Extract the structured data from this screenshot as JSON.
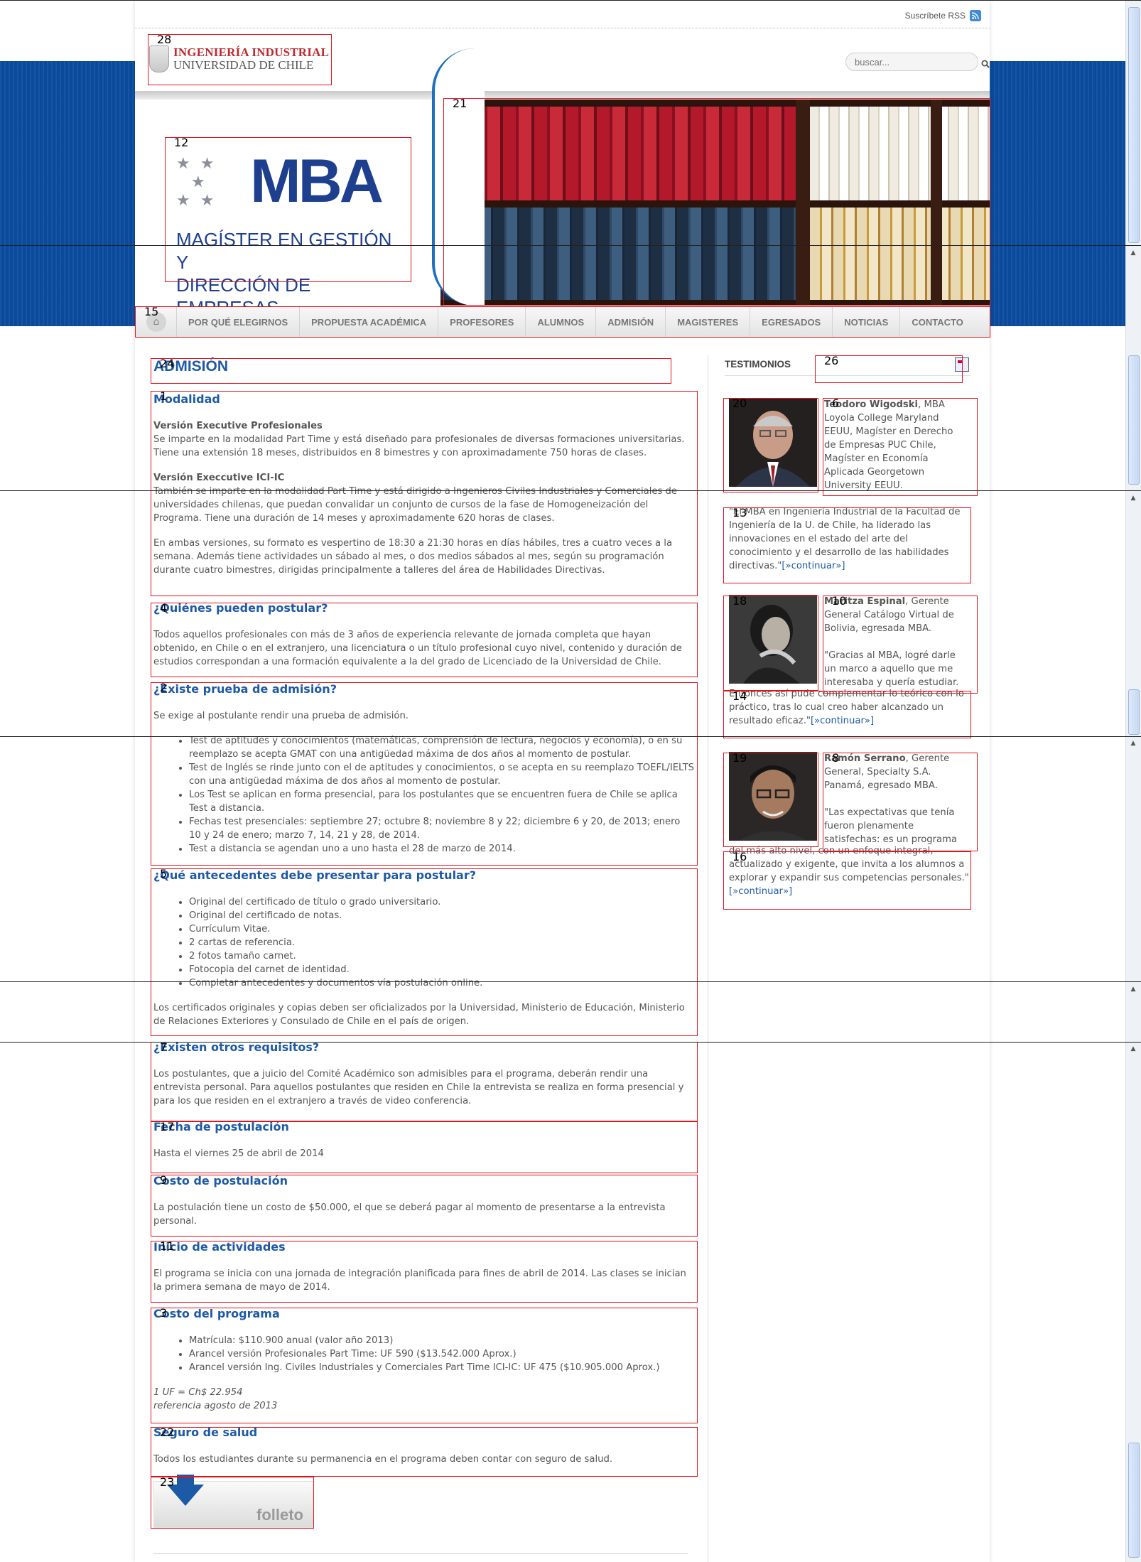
{
  "header": {
    "rss_label": "Suscríbete RSS",
    "logo_line1": "INGENIERÍA INDUSTRIAL",
    "logo_line2": "UNIVERSIDAD DE CHILE",
    "search_placeholder": "buscar..."
  },
  "banner": {
    "mba_title": "MBA",
    "mba_sub1": "MAGÍSTER EN GESTIÓN Y",
    "mba_sub2": "DIRECCIÓN DE EMPRESAS"
  },
  "nav": {
    "items": [
      {
        "label": "POR QUÉ ELEGIRNOS"
      },
      {
        "label": "PROPUESTA ACADÉMICA"
      },
      {
        "label": "PROFESORES"
      },
      {
        "label": "ALUMNOS"
      },
      {
        "label": "ADMISIÓN"
      },
      {
        "label": "MAGISTERES"
      },
      {
        "label": "EGRESADOS"
      },
      {
        "label": "NOTICIAS"
      },
      {
        "label": "CONTACTO"
      }
    ]
  },
  "main": {
    "page_title": "ADMISIÓN",
    "modalidad": {
      "title": "Modalidad",
      "sub1": "Versión Executive Profesionales",
      "p1": "Se imparte en la modalidad Part Time y está diseñado para profesionales de diversas formaciones universitarias. Tiene una extensión 18 meses, distribuidos en 8 bimestres y con aproximadamente 750 horas de clases.",
      "sub2": "Versión Execcutive ICI-IC",
      "p2": "También se imparte en la modalidad Part Time y está dirigido a Ingenieros Civiles Industriales y Comerciales de universidades chilenas, que puedan convalidar un conjunto de cursos de la fase de Homogeneización del Programa. Tiene una duración de 14 meses y aproximadamente 620 horas de clases.",
      "p3": "En ambas versiones, su formato es vespertino de 18:30 a 21:30 horas en días hábiles, tres a cuatro veces a la semana. Además tiene actividades un sábado al mes, o dos medios sábados al mes, según su programación durante cuatro bimestres, dirigidas principalmente a talleres del área de Habilidades Directivas."
    },
    "quienes": {
      "title": "¿Quiénes pueden postular?",
      "p1": "Todos aquellos profesionales con más de 3 años de experiencia relevante de jornada completa que hayan obtenido, en Chile o en el extranjero, una licenciatura o un título profesional cuyo nivel, contenido y duración de estudios correspondan a una formación equivalente a la del grado de Licenciado de la Universidad de Chile."
    },
    "prueba": {
      "title": "¿Existe prueba de admisión?",
      "p1": "Se exige al postulante rendir una prueba de admisión.",
      "items": [
        "Test de aptitudes y conocimientos (matemáticas, comprensión de lectura, negocios y economía), o en su reemplazo se acepta GMAT con una antigüedad máxima de dos años al momento de postular.",
        "Test de Inglés se rinde junto con el de aptitudes y conocimientos, o se acepta en su reemplazo TOEFL/IELTS con una antigüedad máxima de dos años al momento de postular.",
        "Los Test se aplican en forma presencial, para los postulantes que se encuentren fuera de Chile se aplica Test a distancia.",
        "Fechas test presenciales: septiembre 27; octubre 8; noviembre 8 y 22; diciembre 6 y 20, de 2013; enero 10 y 24 de enero; marzo 7, 14, 21 y 28, de 2014.",
        "Test a distancia  se agendan uno a uno hasta el 28 de marzo de 2014."
      ]
    },
    "antecedentes": {
      "title": "¿Qué antecedentes debe presentar para postular?",
      "items": [
        "Original del certificado de título o grado universitario.",
        "Original del certificado de notas.",
        "Currículum Vitae.",
        "2 cartas de referencia.",
        "2 fotos tamaño carnet.",
        "Fotocopia del carnet de identidad.",
        "Completar antecedentes y documentos vía postulación online."
      ],
      "p1": "Los certificados originales y copias deben ser oficializados por la Universidad, Ministerio de Educación, Ministerio de Relaciones Exteriores y Consulado de Chile en el país de origen."
    },
    "otros": {
      "title": "¿Existen otros requisitos?",
      "p1": "Los postulantes, que a juicio del Comité Académico son admisibles para el programa, deberán rendir una entrevista personal. Para aquellos postulantes que residen en Chile la entrevista se realiza en forma presencial y para los que residen en el extranjero a través de video conferencia."
    },
    "fecha": {
      "title": "Fecha de postulación",
      "p1": "Hasta el viernes 25 de abril de 2014"
    },
    "costo_post": {
      "title": "Costo de postulación",
      "p1": "La postulación tiene un costo de $50.000, el que se deberá pagar al momento de presentarse a la entrevista personal."
    },
    "inicio": {
      "title": "Inicio de actividades",
      "p1": "El programa se inicia con una jornada de integración planificada para fines de abril de 2014. Las clases se inician la primera semana de mayo de 2014."
    },
    "costo_prog": {
      "title": "Costo del programa",
      "items": [
        "Matrícula: $110.900 anual (valor año 2013)",
        "Arancel versión Profesionales Part Time: UF 590  ($13.542.000 Aprox.)",
        "Arancel versión Ing. Civiles Industriales y Comerciales Part Time ICI-IC: UF 475 ($10.905.000 Aprox.)"
      ],
      "note1": "1 UF = Ch$  22.954",
      "note2": "referencia agosto de 2013"
    },
    "seguro": {
      "title": "Seguro de salud",
      "p1": "Todos los estudiantes durante su permanencia en el programa deben contar con seguro de salud."
    },
    "folleto_label": "folleto"
  },
  "sidebar": {
    "title": "TESTIMONIOS",
    "testimonials": [
      {
        "name": "Teodoro Wigodski",
        "bio": ", MBA Loyola College Maryland EEUU, Magíster en Derecho de Empresas PUC Chile, Magíster en Economía Aplicada Georgetown University EEUU.",
        "quote": "\"El MBA en Ingeniería Industrial de la Facultad de Ingeniería de la U. de Chile, ha liderado las innovaciones en el estado del arte del conocimiento y el desarrollo de las habilidades directivas.\"",
        "link": "[»continuar»]"
      },
      {
        "name": "Maritza Espinal",
        "bio": ", Gerente General Catálogo Virtual de Bolivia, egresada MBA.",
        "quote_a": "\"Gracias al MBA, logré darle un marco a aquello que me interesaba y quería estudiar.",
        "quote": "Entonces así pude complementar lo teórico con lo práctico, tras lo cual creo haber alcanzado un resultado eficaz.\"",
        "link": "[»continuar»]"
      },
      {
        "name": "Ramón Serrano",
        "bio": ", Gerente General, Specialty S.A. Panamá, egresado MBA.",
        "quote_a": "\"Las expectativas que tenía fueron plenamente satisfechas: es un programa",
        "quote": "del más alto nivel, con un enfoque integral, actualizado y exigente, que invita a los alumnos a explorar y expandir sus competencias personales.\"",
        "link": "[»continuar»]"
      }
    ]
  },
  "annotations": {
    "labels": [
      "28",
      "21",
      "12",
      "15",
      "24",
      "26",
      "1",
      "20",
      "6",
      "13",
      "4",
      "18",
      "10",
      "14",
      "2",
      "19",
      "8",
      "16",
      "5",
      "7",
      "17",
      "9",
      "11",
      "3",
      "22",
      "23"
    ]
  }
}
